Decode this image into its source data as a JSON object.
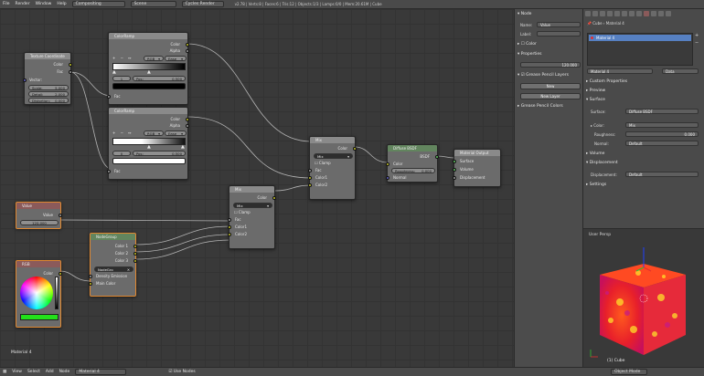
{
  "topbar": {
    "menus": [
      "File",
      "Render",
      "Window",
      "Help"
    ],
    "screen": "Compositing",
    "scene": "Scene",
    "engine": "Cycles Render",
    "stats": "v2.78 | Verts:8 | Faces:6 | Tris:12 | Objects:1/3 | Lamps:0/0 | Mem:20.61M | Cube"
  },
  "nodes": {
    "texcoord": {
      "title": "Texture Coordinate",
      "out_color": "Color",
      "out_fac": "Fac",
      "vector": "Vector:",
      "scale_label": "Scale:",
      "scale": "5.000",
      "detail_label": "Detail:",
      "detail": "2.000",
      "distortion_label": "Distortion:",
      "distortion": "0.000"
    },
    "ramp1": {
      "title": "ColorRamp",
      "out_color": "Color",
      "out_alpha": "Alpha",
      "mode": "RGB",
      "interp": "Ease",
      "index": "1",
      "pos_label": "Pos:",
      "pos": "0.500",
      "fac": "Fac"
    },
    "ramp2": {
      "title": "ColorRamp",
      "out_color": "Color",
      "out_alpha": "Alpha",
      "mode": "RGB",
      "interp": "Ease",
      "index": "0",
      "pos_label": "Pos:",
      "pos": "0.500",
      "fac": "Fac"
    },
    "value": {
      "title": "Value",
      "out": "Value",
      "val": "120.000"
    },
    "rgb": {
      "title": "RGB",
      "out": "Color"
    },
    "group": {
      "title": "NodeGroup",
      "o1": "Color 1",
      "o2": "Color 2",
      "o3": "Color 3",
      "field": "NodeGro",
      "density": "Density Emission",
      "main": "Main Color"
    },
    "mix1": {
      "title": "Mix",
      "out": "Color",
      "mode": "Mix",
      "clamp": "Clamp",
      "fac": "Fac",
      "c1": "Color1",
      "c2": "Color2"
    },
    "mix2": {
      "title": "Mix",
      "out": "Color",
      "mode": "Mix",
      "clamp": "Clamp",
      "fac": "Fac",
      "c1": "Color1",
      "c2": "Color2"
    },
    "diffuse": {
      "title": "Diffuse BSDF",
      "out": "BSDF",
      "color": "Color",
      "rough_label": "Roughness:",
      "rough": "0.000",
      "normal": "Normal"
    },
    "output": {
      "title": "Material Output",
      "surface": "Surface",
      "volume": "Volume",
      "displacement": "Displacement"
    }
  },
  "editor_label": "Material 4",
  "sidebar": {
    "node_header": "Node",
    "name_label": "Name:",
    "name_value": "Value",
    "label_label": "Label:",
    "color_header": "Color",
    "properties_header": "Properties",
    "prop_value": "120.000",
    "gp_layers_header": "Grease Pencil Layers",
    "new_button": "New",
    "new_layer_button": "New Layer",
    "gp_colors_header": "Grease Pencil Colors"
  },
  "props": {
    "breadcrumb_obj": "Cube",
    "breadcrumb_mat": "Material 4",
    "slot": "Material 4",
    "mat_field": "Material 4",
    "data_field": "Data",
    "sections": [
      "Custom Properties",
      "Preview",
      "Surface"
    ],
    "surface_label": "Surface:",
    "surface_value": "Diffuse BSDF",
    "color_label": "Color:",
    "color_value": "Mix",
    "roughness_label": "Roughness:",
    "roughness_value": "0.000",
    "normal_label": "Normal:",
    "normal_value": "Default",
    "volume": "Volume",
    "displacement_header": "Displacement",
    "displacement_label": "Displacement:",
    "displacement_value": "Default",
    "settings": "Settings"
  },
  "view3d": {
    "label": "User Persp",
    "object": "(1) Cube"
  },
  "bottombar": {
    "menus": [
      "View",
      "Select",
      "Add",
      "Node"
    ],
    "material": "Material 4",
    "use_nodes": "Use Nodes",
    "mode": "Object Mode"
  },
  "colors": {
    "accent": "#e08830",
    "selection": "#5680c2",
    "header": "#4a4a4a"
  }
}
